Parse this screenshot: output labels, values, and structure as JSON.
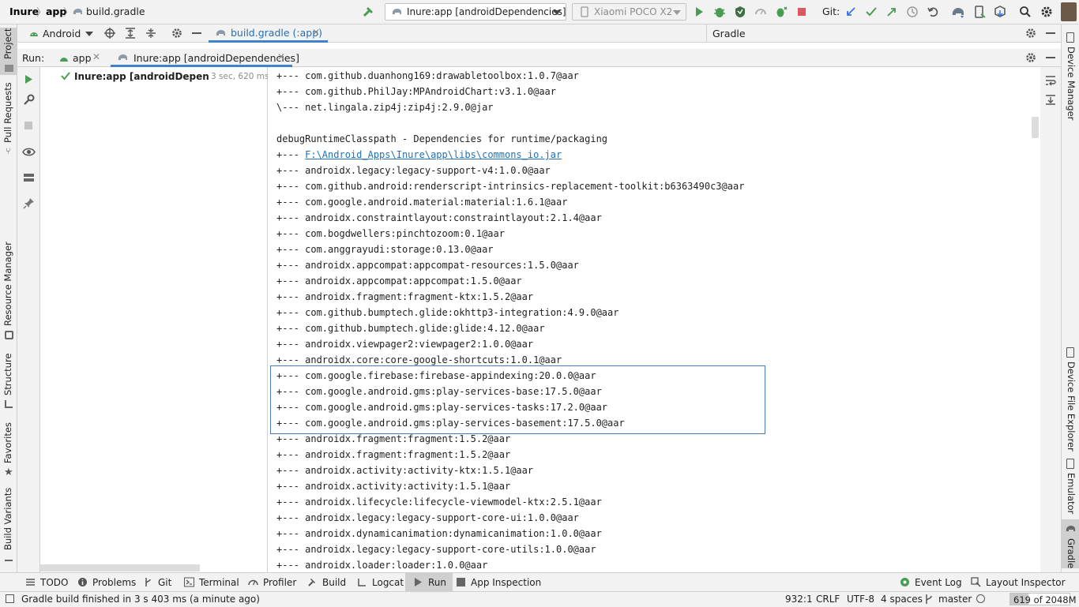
{
  "breadcrumb": {
    "project": "Inure",
    "module": "app",
    "file": "build.gradle"
  },
  "toolbar": {
    "run_config": "Inure:app [androidDependencies]",
    "device": "Xiaomi POCO X2",
    "git_label": "Git:"
  },
  "left_stripe": [
    "Project",
    "Pull Requests",
    "Resource Manager",
    "Structure",
    "Favorites",
    "Build Variants"
  ],
  "right_stripe": [
    "Device Manager",
    "Device File Explorer",
    "Emulator",
    "Gradle"
  ],
  "project_panel": {
    "view_mode": "Android",
    "editor_tab": "build.gradle (:app)",
    "gradle_title": "Gradle"
  },
  "run_panel": {
    "label": "Run:",
    "tabs": [
      "app",
      "Inure:app [androidDependencies]"
    ],
    "tree_item": {
      "label": "Inure:app [androidDependencies]",
      "time": "3 sec, 620 ms"
    }
  },
  "console": {
    "lines": [
      "+--- com.github.duanhong169:drawabletoolbox:1.0.7@aar",
      "+--- com.github.PhilJay:MPAndroidChart:v3.1.0@aar",
      "\\--- net.lingala.zip4j:zip4j:2.9.0@jar",
      "",
      "debugRuntimeClasspath - Dependencies for runtime/packaging",
      "+--- ",
      "+--- androidx.legacy:legacy-support-v4:1.0.0@aar",
      "+--- com.github.android:renderscript-intrinsics-replacement-toolkit:b6363490c3@aar",
      "+--- com.google.android.material:material:1.6.1@aar",
      "+--- androidx.constraintlayout:constraintlayout:2.1.4@aar",
      "+--- com.bogdwellers:pinchtozoom:0.1@aar",
      "+--- com.anggrayudi:storage:0.13.0@aar",
      "+--- androidx.appcompat:appcompat-resources:1.5.0@aar",
      "+--- androidx.appcompat:appcompat:1.5.0@aar",
      "+--- androidx.fragment:fragment-ktx:1.5.2@aar",
      "+--- com.github.bumptech.glide:okhttp3-integration:4.9.0@aar",
      "+--- com.github.bumptech.glide:glide:4.12.0@aar",
      "+--- androidx.viewpager2:viewpager2:1.0.0@aar",
      "+--- androidx.core:core-google-shortcuts:1.0.1@aar",
      "+--- com.google.firebase:firebase-appindexing:20.0.0@aar",
      "+--- com.google.android.gms:play-services-base:17.5.0@aar",
      "+--- com.google.android.gms:play-services-tasks:17.2.0@aar",
      "+--- com.google.android.gms:play-services-basement:17.5.0@aar",
      "+--- androidx.fragment:fragment:1.5.2@aar",
      "+--- androidx.fragment:fragment:1.5.2@aar",
      "+--- androidx.activity:activity-ktx:1.5.1@aar",
      "+--- androidx.activity:activity:1.5.1@aar",
      "+--- androidx.lifecycle:lifecycle-viewmodel-ktx:2.5.1@aar",
      "+--- androidx.legacy:legacy-support-core-ui:1.0.0@aar",
      "+--- androidx.dynamicanimation:dynamicanimation:1.0.0@aar",
      "+--- androidx.legacy:legacy-support-core-utils:1.0.0@aar",
      "+--- androidx.loader:loader:1.0.0@aar"
    ],
    "link_text": "F:\\Android_Apps\\Inure\\app\\libs\\commons_io.jar"
  },
  "bottom_tabs": [
    "TODO",
    "Problems",
    "Git",
    "Terminal",
    "Profiler",
    "Build",
    "Logcat",
    "Run",
    "App Inspection",
    "Event Log",
    "Layout Inspector"
  ],
  "status": {
    "message": "Gradle build finished in 3 s 403 ms (a minute ago)",
    "position": "932:1",
    "line_sep": "CRLF",
    "encoding": "UTF-8",
    "indent": "4 spaces",
    "branch": "master",
    "memory": "619 of 2048M"
  },
  "colors": {
    "run_green": "#499c54",
    "link_blue": "#2470b3",
    "stop_red": "#db5860",
    "git_blue": "#3574f0"
  }
}
